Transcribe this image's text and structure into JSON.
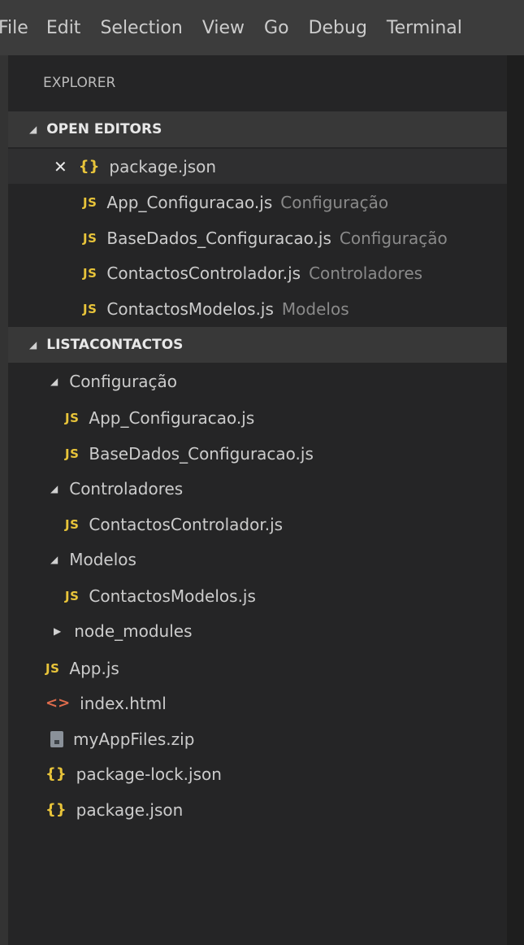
{
  "menubar": {
    "items": [
      "File",
      "Edit",
      "Selection",
      "View",
      "Go",
      "Debug",
      "Terminal"
    ]
  },
  "explorer": {
    "title": "EXPLORER",
    "open_editors": {
      "header": "OPEN EDITORS",
      "items": [
        {
          "name": "package.json",
          "desc": "",
          "icon": "json-icon",
          "active": true
        },
        {
          "name": "App_Configuracao.js",
          "desc": "Configuração",
          "icon": "js-icon"
        },
        {
          "name": "BaseDados_Configuracao.js",
          "desc": "Configuração",
          "icon": "js-icon"
        },
        {
          "name": "ContactosControlador.js",
          "desc": "Controladores",
          "icon": "js-icon"
        },
        {
          "name": "ContactosModelos.js",
          "desc": "Modelos",
          "icon": "js-icon"
        }
      ]
    },
    "project": {
      "header": "LISTACONTACTOS",
      "tree": [
        {
          "name": "Configuração",
          "type": "folder",
          "expanded": true
        },
        {
          "name": "App_Configuracao.js",
          "type": "js"
        },
        {
          "name": "BaseDados_Configuracao.js",
          "type": "js"
        },
        {
          "name": "Controladores",
          "type": "folder",
          "expanded": true
        },
        {
          "name": "ContactosControlador.js",
          "type": "js"
        },
        {
          "name": "Modelos",
          "type": "folder",
          "expanded": true
        },
        {
          "name": "ContactosModelos.js",
          "type": "js"
        },
        {
          "name": "node_modules",
          "type": "folder",
          "expanded": false
        },
        {
          "name": "App.js",
          "type": "js"
        },
        {
          "name": "index.html",
          "type": "html"
        },
        {
          "name": "myAppFiles.zip",
          "type": "zip"
        },
        {
          "name": "package-lock.json",
          "type": "json"
        },
        {
          "name": "package.json",
          "type": "json"
        }
      ]
    }
  },
  "icons": {
    "js": "JS",
    "json": "{}",
    "html": "<>",
    "close": "✕"
  },
  "colors": {
    "js_icon": "#e8c43a",
    "json_icon": "#e8c43a",
    "html_icon": "#e06c4c",
    "description": "#8a8a8a"
  }
}
